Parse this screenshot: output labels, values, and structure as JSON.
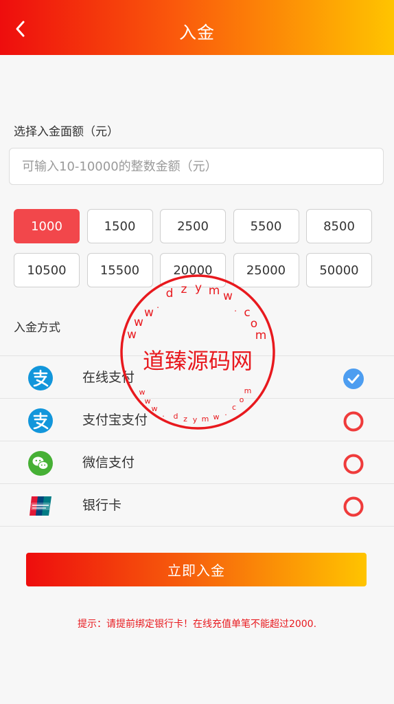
{
  "header": {
    "title": "入金",
    "back_icon": "chevron-left-icon",
    "gradient": [
      "#ee0d0d",
      "#ffc400"
    ]
  },
  "amount": {
    "label": "选择入金面额（元）",
    "placeholder": "可输入10-10000的整数金额（元）",
    "options": [
      "1000",
      "1500",
      "2500",
      "5500",
      "8500",
      "10500",
      "15500",
      "20000",
      "25000",
      "50000"
    ],
    "selected": "1000",
    "active_color": "#f2474b"
  },
  "payment": {
    "label": "入金方式",
    "methods": [
      {
        "name": "在线支付",
        "icon": "alipay-icon",
        "selected": true
      },
      {
        "name": "支付宝支付",
        "icon": "alipay-icon",
        "selected": false
      },
      {
        "name": "微信支付",
        "icon": "wechat-icon",
        "selected": false
      },
      {
        "name": "银行卡",
        "icon": "unionpay-icon",
        "selected": false
      }
    ]
  },
  "submit": {
    "label": "立即入金"
  },
  "tip": "提示：请提前绑定银行卡！在线充值单笔不能超过2000.",
  "watermark": {
    "center_text": "道臻源码网",
    "ring_text": "www.dzymw.com",
    "color": "#e8191e"
  }
}
